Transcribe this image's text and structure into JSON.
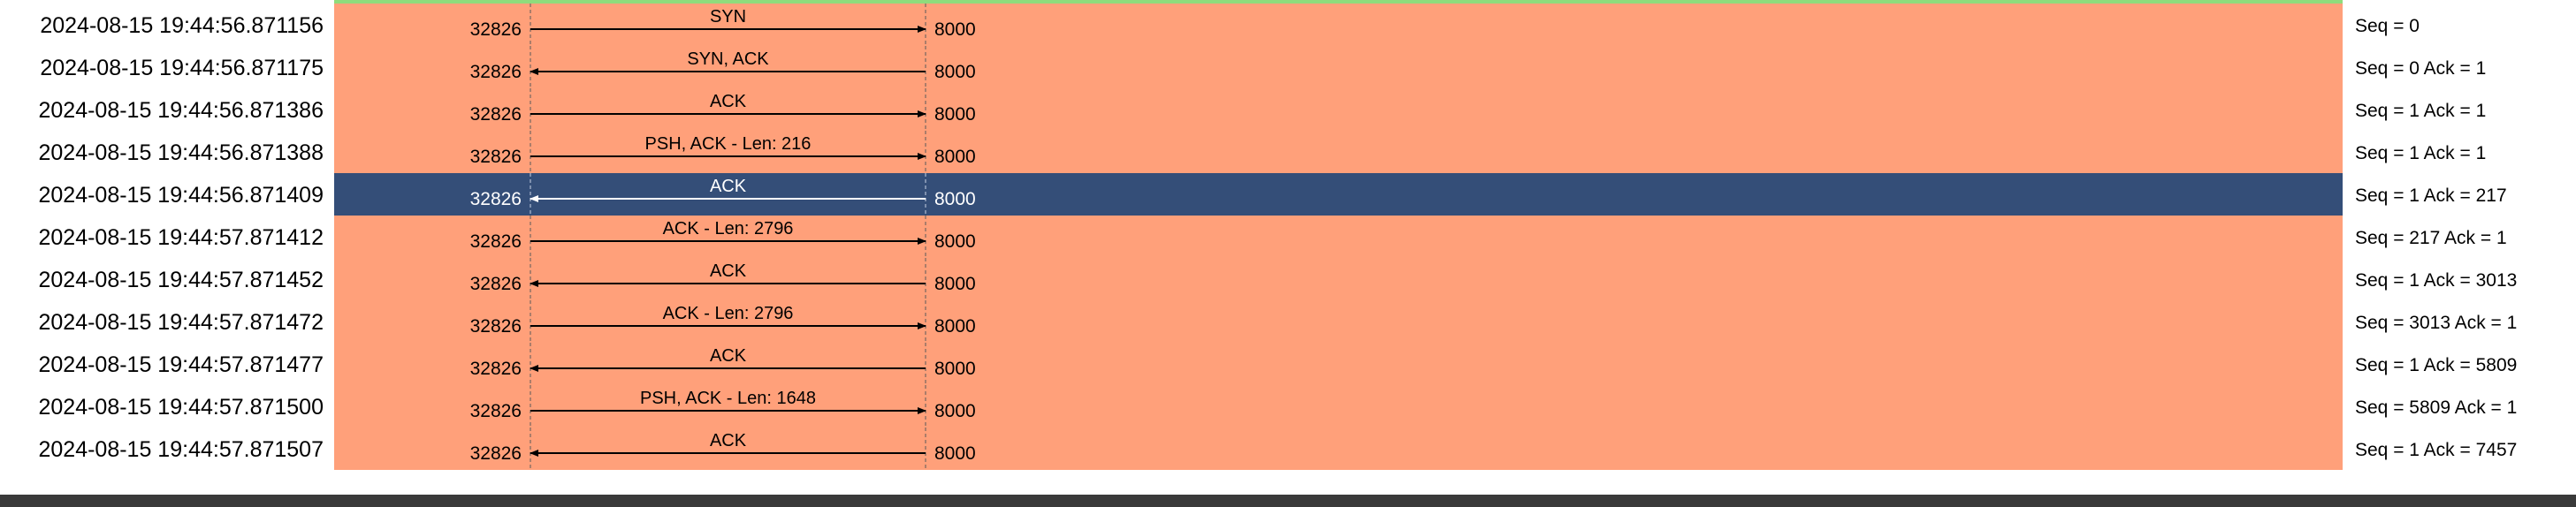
{
  "colors": {
    "row_bg": "#ffa07a",
    "selected_bg": "#344e78",
    "top_accent": "#8fdc7c",
    "bottom_band": "#3a3a3a",
    "text": "#000000",
    "selected_text": "#ffffff"
  },
  "rows": [
    {
      "time": "2024-08-15 19:44:56.871156",
      "src_port": "32826",
      "dst_port": "8000",
      "label": "SYN",
      "direction": "right",
      "comment": "Seq = 0",
      "selected": false
    },
    {
      "time": "2024-08-15 19:44:56.871175",
      "src_port": "32826",
      "dst_port": "8000",
      "label": "SYN, ACK",
      "direction": "left",
      "comment": "Seq = 0 Ack = 1",
      "selected": false
    },
    {
      "time": "2024-08-15 19:44:56.871386",
      "src_port": "32826",
      "dst_port": "8000",
      "label": "ACK",
      "direction": "right",
      "comment": "Seq = 1 Ack = 1",
      "selected": false
    },
    {
      "time": "2024-08-15 19:44:56.871388",
      "src_port": "32826",
      "dst_port": "8000",
      "label": "PSH, ACK - Len: 216",
      "direction": "right",
      "comment": "Seq = 1 Ack = 1",
      "selected": false
    },
    {
      "time": "2024-08-15 19:44:56.871409",
      "src_port": "32826",
      "dst_port": "8000",
      "label": "ACK",
      "direction": "left",
      "comment": "Seq = 1 Ack = 217",
      "selected": true
    },
    {
      "time": "2024-08-15 19:44:57.871412",
      "src_port": "32826",
      "dst_port": "8000",
      "label": "ACK - Len: 2796",
      "direction": "right",
      "comment": "Seq = 217 Ack = 1",
      "selected": false
    },
    {
      "time": "2024-08-15 19:44:57.871452",
      "src_port": "32826",
      "dst_port": "8000",
      "label": "ACK",
      "direction": "left",
      "comment": "Seq = 1 Ack = 3013",
      "selected": false
    },
    {
      "time": "2024-08-15 19:44:57.871472",
      "src_port": "32826",
      "dst_port": "8000",
      "label": "ACK - Len: 2796",
      "direction": "right",
      "comment": "Seq = 3013 Ack = 1",
      "selected": false
    },
    {
      "time": "2024-08-15 19:44:57.871477",
      "src_port": "32826",
      "dst_port": "8000",
      "label": "ACK",
      "direction": "left",
      "comment": "Seq = 1 Ack = 5809",
      "selected": false
    },
    {
      "time": "2024-08-15 19:44:57.871500",
      "src_port": "32826",
      "dst_port": "8000",
      "label": "PSH, ACK - Len: 1648",
      "direction": "right",
      "comment": "Seq = 5809 Ack = 1",
      "selected": false
    },
    {
      "time": "2024-08-15 19:44:57.871507",
      "src_port": "32826",
      "dst_port": "8000",
      "label": "ACK",
      "direction": "left",
      "comment": "Seq = 1 Ack = 7457",
      "selected": false
    }
  ]
}
